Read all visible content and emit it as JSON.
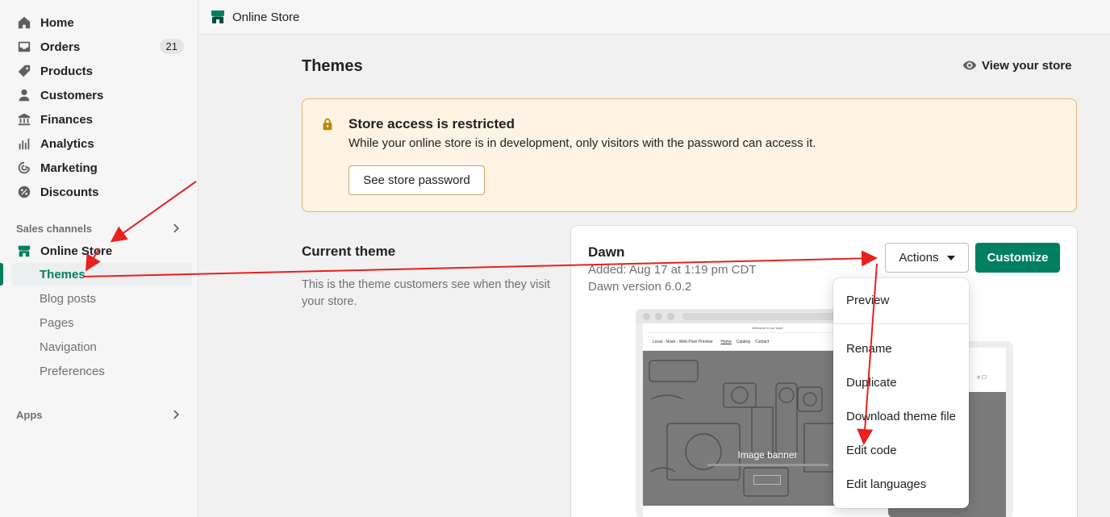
{
  "sidebar": {
    "items": [
      {
        "label": "Home",
        "icon": "home-icon"
      },
      {
        "label": "Orders",
        "icon": "orders-icon",
        "badge": "21"
      },
      {
        "label": "Products",
        "icon": "tag-icon"
      },
      {
        "label": "Customers",
        "icon": "person-icon"
      },
      {
        "label": "Finances",
        "icon": "bank-icon"
      },
      {
        "label": "Analytics",
        "icon": "bar-chart-icon"
      },
      {
        "label": "Marketing",
        "icon": "target-icon"
      },
      {
        "label": "Discounts",
        "icon": "discount-icon"
      }
    ],
    "sales_channels": "Sales channels",
    "online_store": "Online Store",
    "sub_items": [
      "Themes",
      "Blog posts",
      "Pages",
      "Navigation",
      "Preferences"
    ],
    "apps": "Apps"
  },
  "topbar": {
    "title": "Online Store"
  },
  "main": {
    "title": "Themes",
    "view_store": "View your store",
    "banner": {
      "title": "Store access is restricted",
      "text": "While your online store is in development, only visitors with the password can access it.",
      "button": "See store password"
    },
    "current_theme": {
      "heading": "Current theme",
      "description": "This is the theme customers see when they visit your store."
    },
    "theme": {
      "name": "Dawn",
      "added": "Added: Aug 17 at 1:19 pm CDT",
      "version": "Dawn version 6.0.2",
      "actions": "Actions",
      "customize": "Customize"
    },
    "preview": {
      "announcement": "Welcome to our store",
      "store_name": "Local - Noah - Web Pixel Preview",
      "nav": [
        "Home",
        "Catalog",
        "Contact"
      ],
      "banner_text": "Image banner",
      "mobile_text": "ner"
    }
  },
  "dropdown": {
    "items": [
      "Preview",
      "Rename",
      "Duplicate",
      "Download theme file",
      "Edit code",
      "Edit languages"
    ]
  },
  "colors": {
    "brand_green": "#008060",
    "annotation_red": "#e8201e",
    "banner_bg": "#fff4e4"
  }
}
